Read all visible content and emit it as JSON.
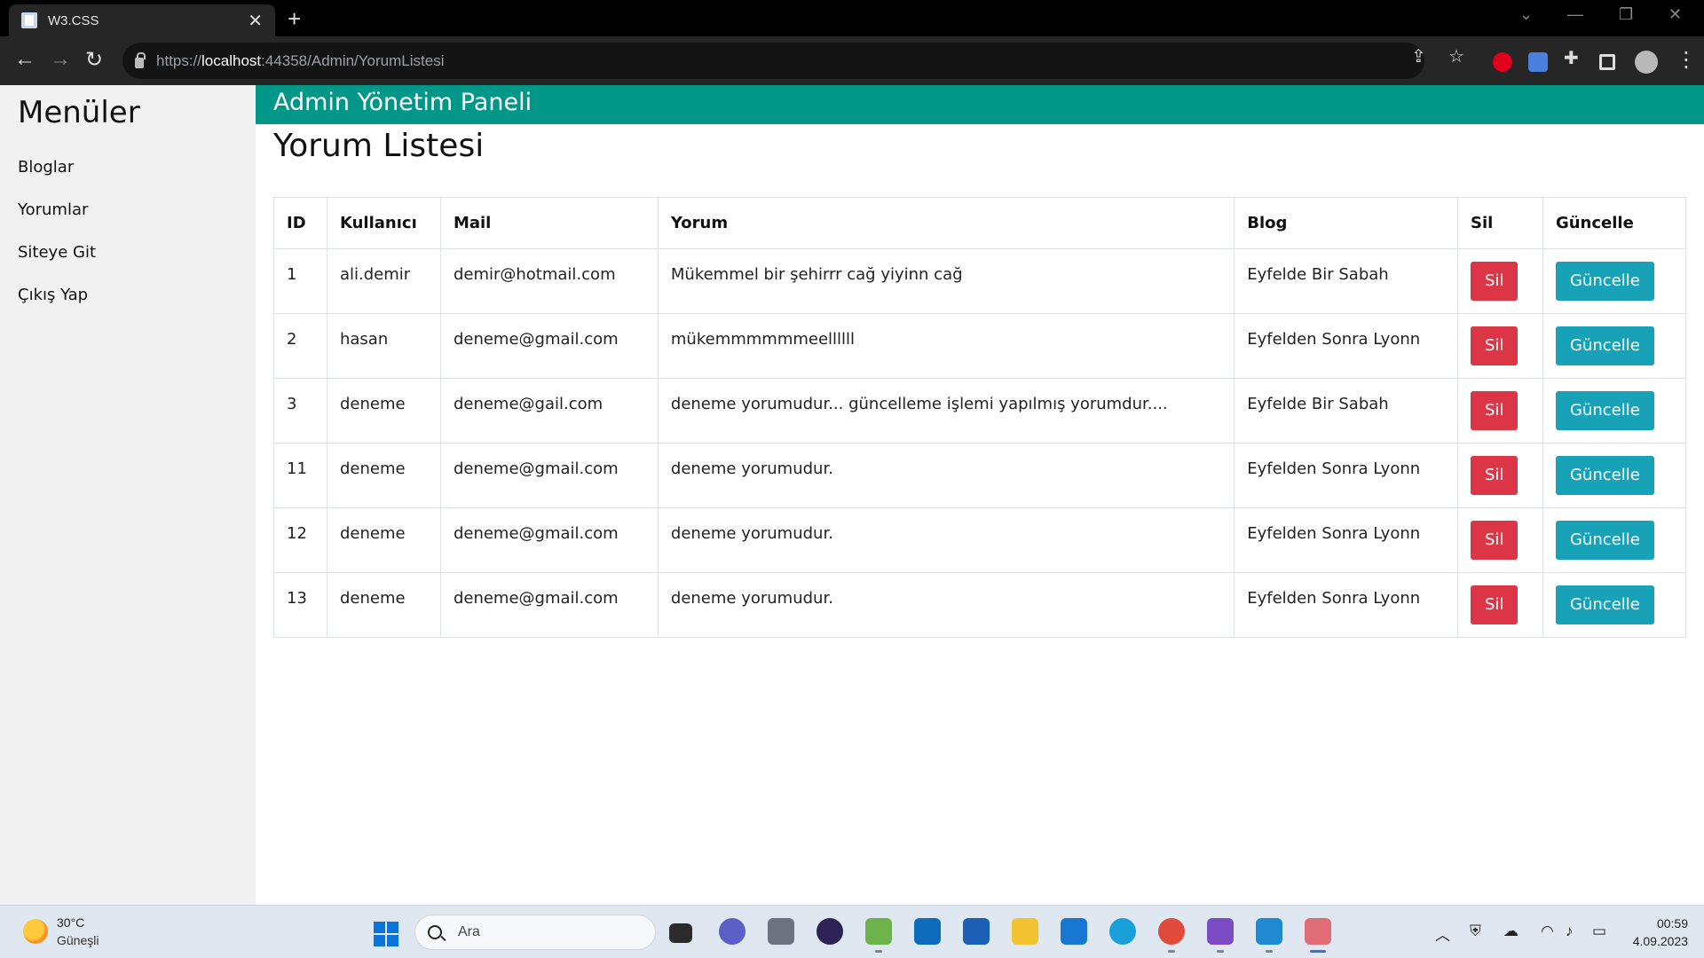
{
  "browser": {
    "tab_title": "W3.CSS",
    "tab_close": "✕",
    "new_tab": "+",
    "url_scheme": "https://",
    "url_host": "localhost",
    "url_path": ":44358/Admin/YorumListesi"
  },
  "sidebar": {
    "title": "Menüler",
    "items": [
      {
        "label": "Bloglar"
      },
      {
        "label": "Yorumlar"
      },
      {
        "label": "Siteye Git"
      },
      {
        "label": "Çıkış Yap"
      }
    ]
  },
  "header": {
    "title": "Admin Yönetim Paneli"
  },
  "main": {
    "heading": "Yorum Listesi",
    "columns": [
      "ID",
      "Kullanıcı",
      "Mail",
      "Yorum",
      "Blog",
      "Sil",
      "Güncelle"
    ],
    "delete_label": "Sil",
    "update_label": "Güncelle",
    "rows": [
      {
        "id": "1",
        "user": "ali.demir",
        "mail": "demir@hotmail.com",
        "comment": "Mükemmel bir şehirrr cağ yiyinn cağ",
        "blog": "Eyfelde Bir Sabah"
      },
      {
        "id": "2",
        "user": "hasan",
        "mail": "deneme@gmail.com",
        "comment": "mükemmmmmmeellllll",
        "blog": "Eyfelden Sonra Lyonn"
      },
      {
        "id": "3",
        "user": "deneme",
        "mail": "deneme@gail.com",
        "comment": "deneme yorumudur... güncelleme işlemi yapılmış yorumdur....",
        "blog": "Eyfelde Bir Sabah"
      },
      {
        "id": "11",
        "user": "deneme",
        "mail": "deneme@gmail.com",
        "comment": "deneme yorumudur.",
        "blog": "Eyfelden Sonra Lyonn"
      },
      {
        "id": "12",
        "user": "deneme",
        "mail": "deneme@gmail.com",
        "comment": "deneme yorumudur.",
        "blog": "Eyfelden Sonra Lyonn"
      },
      {
        "id": "13",
        "user": "deneme",
        "mail": "deneme@gmail.com",
        "comment": "deneme yorumudur.",
        "blog": "Eyfelden Sonra Lyonn"
      }
    ]
  },
  "taskbar": {
    "weather_temp": "30°C",
    "weather_desc": "Güneşli",
    "search_placeholder": "Ara",
    "time": "00:59",
    "date": "4.09.2023"
  },
  "colors": {
    "header_bg": "#009688",
    "delete_button": "#dc3545",
    "update_button": "#17a2b8",
    "sidebar_bg": "#f1f1f1"
  }
}
